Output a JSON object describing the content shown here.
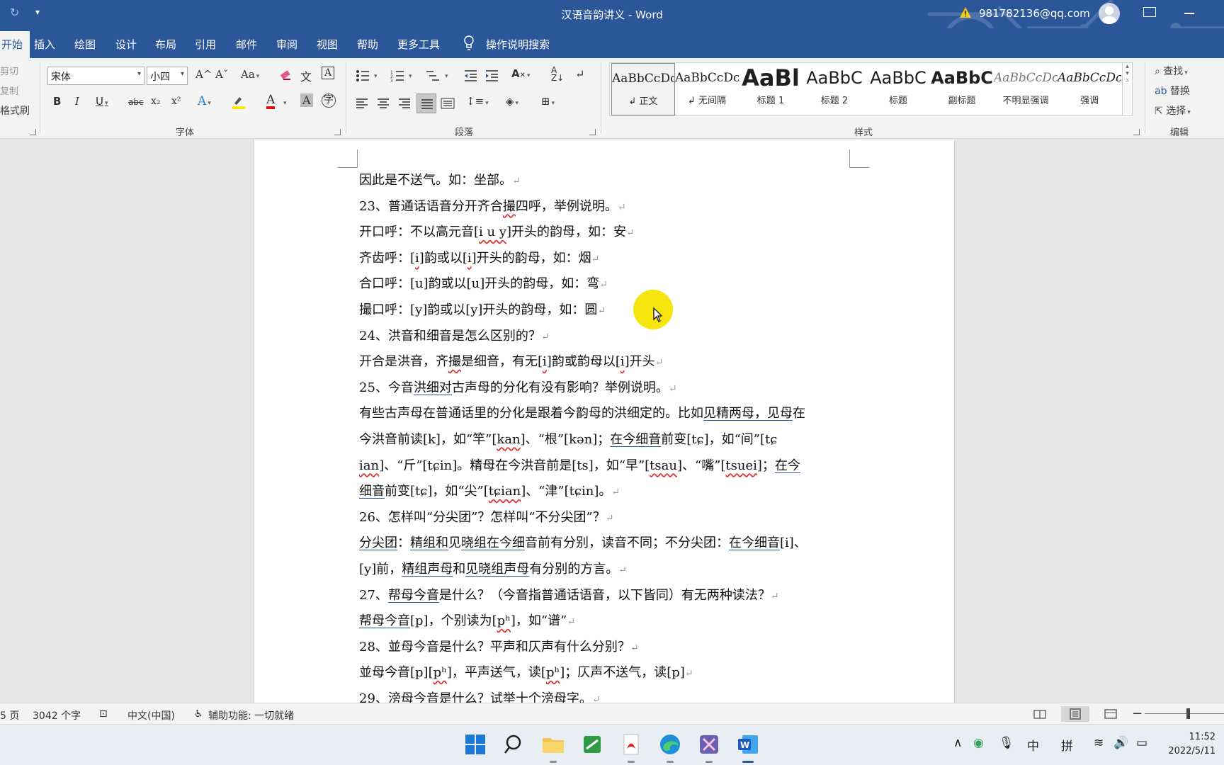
{
  "window": {
    "title": "汉语音韵讲义 - Word",
    "account": "981782136@qq.com"
  },
  "tabs": [
    {
      "label": "开始",
      "active": true
    },
    {
      "label": "插入"
    },
    {
      "label": "绘图"
    },
    {
      "label": "设计"
    },
    {
      "label": "布局"
    },
    {
      "label": "引用"
    },
    {
      "label": "邮件"
    },
    {
      "label": "审阅"
    },
    {
      "label": "视图"
    },
    {
      "label": "帮助"
    },
    {
      "label": "更多工具"
    },
    {
      "label": "操作说明搜索"
    }
  ],
  "ribbon": {
    "clipboard": {
      "cut": "剪切",
      "copy": "复制",
      "format_painter": "格式刷"
    },
    "font": {
      "name": "宋体",
      "size": "小四",
      "group_label": "字体",
      "bold": "B",
      "italic": "I",
      "underline": "U",
      "strike": "abc",
      "subscript": "x₂",
      "superscript": "x²",
      "case": "Aa",
      "grow": "A^",
      "shrink": "Aˇ",
      "phonetic": "文",
      "border": "A",
      "enclose": "字"
    },
    "paragraph": {
      "group_label": "段落"
    },
    "styles": {
      "group_label": "样式",
      "items": [
        {
          "sample": "AaBbCcDc",
          "name": "↲ 正文"
        },
        {
          "sample": "AaBbCcDc",
          "name": "↲ 无间隔"
        },
        {
          "sample": "AaBl",
          "name": "标题 1"
        },
        {
          "sample": "AaBbC",
          "name": "标题 2"
        },
        {
          "sample": "AaBbC",
          "name": "标题"
        },
        {
          "sample": "AaBbC",
          "name": "副标题"
        },
        {
          "sample": "AaBbCcDc",
          "name": "不明显强调"
        },
        {
          "sample": "AaBbCcDc",
          "name": "强调"
        }
      ]
    },
    "editing": {
      "group_label": "编辑",
      "find": "查找",
      "replace": "替换",
      "select": "选择"
    }
  },
  "document": {
    "l1": "因此是不送气。如：坐部。",
    "l2a": "23、普通话语音分开齐合",
    "l2b": "撮",
    "l2c": "四呼，举例说明。",
    "l3a": "开口呼：不以高元音[",
    "l3b": "i u y",
    "l3c": "]开头的韵母，如：安",
    "l4a": "齐齿呼：[",
    "l4b": "i",
    "l4c": "]韵或以[",
    "l4d": "i",
    "l4e": "]开头的韵母，如：烟",
    "l5": "合口呼：[u]韵或以[u]开头的韵母，如：弯",
    "l6": "撮口呼：[y]韵或以[y]开头的韵母，如：圆",
    "l7": "24、洪音和细音是怎么区别的？",
    "l8a": "开合是洪音，齐",
    "l8b": "撮",
    "l8c": "是细音，有无[",
    "l8d": "i",
    "l8e": "]韵或韵母以[",
    "l8f": "i",
    "l8g": "]开头",
    "l9a": "25、今音",
    "l9b": "洪细对",
    "l9c": "古声母的分化有没有影响？举例说明。",
    "l10a": "有些古声母在普通话里的分化是跟着今韵母的洪细定的。比如",
    "l10b": "见精两母，见母",
    "l10c": "在",
    "l11a": "今洪音前读[k]，如“竿”[",
    "l11b": "kan",
    "l11c": "]、“根”[kən]；",
    "l11d": "在今细音",
    "l11e": "前变[tɕ]，如“间”[tɕ",
    "l12a": "ian",
    "l12b": "]、“斤”[tɕin]。精母在今洪音前是[ts]，如“早”[",
    "l12c": "tsau",
    "l12d": "]、“嘴”[",
    "l12e": "tsuei",
    "l12f": "]；",
    "l12g": "在今",
    "l13a": "细音",
    "l13b": "前变[tɕ]，如“尖”[",
    "l13c": "tɕian",
    "l13d": "]、“津”[tɕin]。",
    "l14": "26、怎样叫“分尖团”？怎样叫“不分尖团”？",
    "l15a": "分尖团",
    "l15b": "：",
    "l15c": "精组和",
    "l15d": "见",
    "l15e": "晓组在今细",
    "l15f": "音前有分别，读音不同；不分尖团：",
    "l15g": "在今细音",
    "l15h": "[i]、",
    "l16a": "[y]前，",
    "l16b": "精组声母",
    "l16c": "和",
    "l16d": "见晓组声母",
    "l16e": "有分别的方言。",
    "l17a": "27、",
    "l17b": "帮母今音",
    "l17c": "是什么？（今音指普通话语音，以下皆同）有无两种读法？",
    "l18a": "帮母今音",
    "l18b": "[p]，个别读为[",
    "l18c": "pʰ",
    "l18d": "]，如“谱”",
    "l19": "28、並母今音是什么？平声和仄声有什么分别？",
    "l20a": "並母今音[p][",
    "l20b": "pʰ",
    "l20c": "]，平声送气，读[",
    "l20d": "pʰ",
    "l20e": "]；仄声不送气，读[p]",
    "l21": "29、滂母今音是什么？试举十个滂母字。",
    "para_mark": "↵"
  },
  "status": {
    "page": "5 页",
    "words": "3042 个字",
    "language": "中文(中国)",
    "accessibility": "辅助功能: 一切就绪"
  },
  "taskbar": {
    "ime_mode": "中",
    "ime_pinyin": "拼",
    "time": "11:52",
    "date": "2022/5/11"
  },
  "colors": {
    "word_blue": "#2b579a",
    "pointer_highlight": "#f4e400",
    "spell_error": "#d33333"
  }
}
